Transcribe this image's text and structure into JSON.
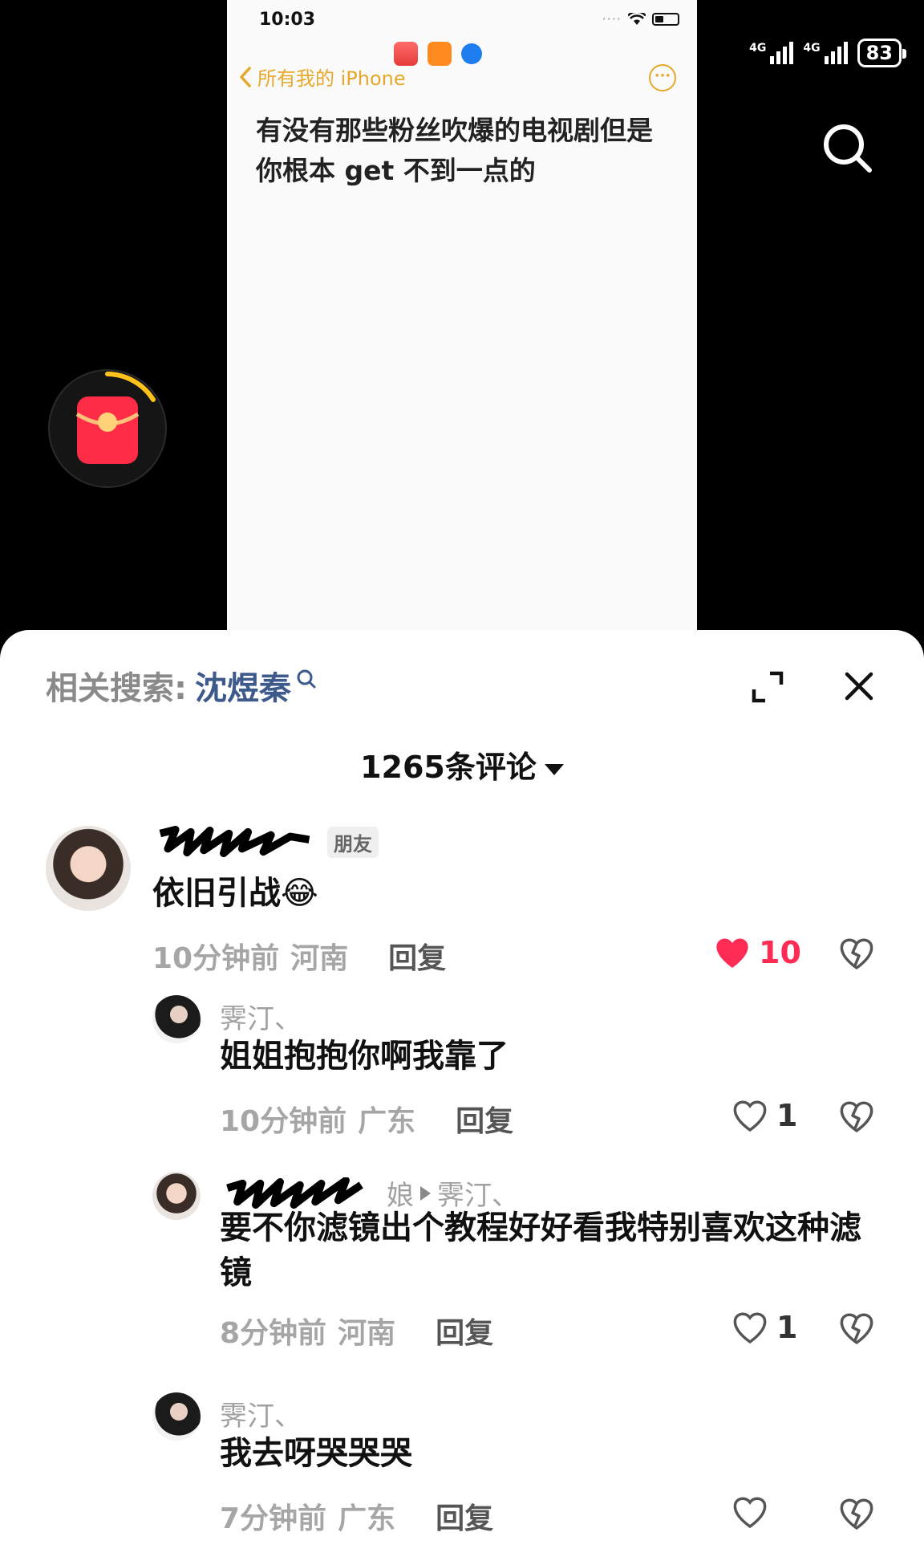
{
  "video": {
    "embedded_screen": {
      "time": "10:03",
      "back_label": "所有我的 iPhone",
      "note_text": "有没有那些粉丝吹爆的电视剧但是你根本 get 不到一点的"
    },
    "status_bar": {
      "net1": "4G",
      "net2": "4G",
      "battery": "83"
    }
  },
  "sheet": {
    "related_label": "相关搜索:",
    "related_term": "沈煜秦",
    "comment_count": "1265条评论",
    "comments": [
      {
        "badge": "朋友",
        "text": "依旧引战😂",
        "time": "10分钟前",
        "location": "河南",
        "reply": "回复",
        "likes": "10",
        "liked": true
      },
      {
        "name": "霁汀、",
        "text": "姐姐抱抱你啊我靠了",
        "time": "10分钟前",
        "location": "广东",
        "reply": "回复",
        "likes": "1"
      },
      {
        "name_suffix": "娘",
        "reply_to": "霁汀、",
        "text": "要不你滤镜出个教程好好看我特别喜欢这种滤镜",
        "time": "8分钟前",
        "location": "河南",
        "reply": "回复",
        "likes": "1"
      },
      {
        "name": "霁汀、",
        "text": "我去呀哭哭哭",
        "time": "7分钟前",
        "location": "广东",
        "reply": "回复",
        "likes": ""
      }
    ]
  },
  "colors": {
    "like_active": "#fe2c55",
    "note_accent": "#e6a82a",
    "related_term": "#3d5a8a"
  }
}
